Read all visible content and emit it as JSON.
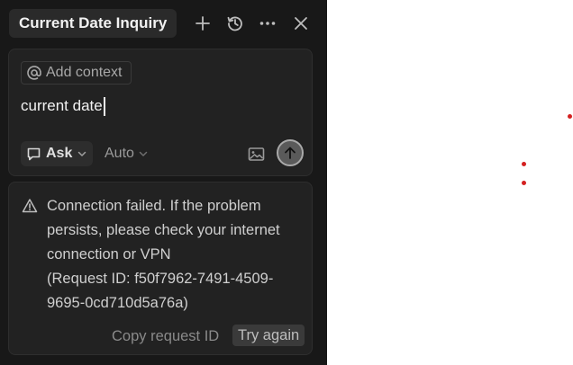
{
  "header": {
    "title": "Current Date Inquiry",
    "buttons": [
      {
        "name": "new-chat",
        "icon": "plus-icon"
      },
      {
        "name": "history",
        "icon": "history-icon"
      },
      {
        "name": "more",
        "icon": "ellipsis-icon"
      },
      {
        "name": "close",
        "icon": "close-icon"
      }
    ]
  },
  "composer": {
    "context_label": "Add context",
    "context_icon": "at-sign-icon",
    "input_value": "current date",
    "mode_label": "Ask",
    "mode_icon": "chat-bubble-icon",
    "model_label": "Auto",
    "image_icon": "image-icon",
    "send_icon": "arrow-up-icon"
  },
  "error": {
    "icon": "warning-icon",
    "lines": [
      "Connection failed. If the problem",
      "persists, please check your internet",
      "connection or VPN",
      "(Request ID: f50f7962-7491-4509-",
      "9695-0cd710d5a76a)"
    ],
    "copy_label": "Copy request ID",
    "retry_label": "Try again"
  },
  "colors": {
    "panel_bg": "#181818",
    "card_bg": "#222222",
    "dot": "#d42020"
  }
}
